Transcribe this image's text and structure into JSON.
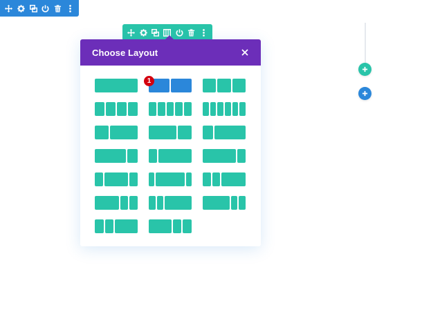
{
  "colors": {
    "section_blue": "#2b87da",
    "row_teal": "#29c4a9",
    "modal_purple": "#6c2eb9",
    "badge_red": "#d3000f"
  },
  "section_toolbar": {
    "icons": [
      "move-icon",
      "gear-icon",
      "duplicate-icon",
      "power-icon",
      "trash-icon",
      "more-icon"
    ]
  },
  "row_toolbar": {
    "icons": [
      "move-icon",
      "gear-icon",
      "duplicate-icon",
      "columns-icon",
      "power-icon",
      "trash-icon",
      "more-icon"
    ]
  },
  "modal": {
    "title": "Choose Layout",
    "close_icon": "close-icon",
    "badge": "1",
    "layouts": [
      {
        "id": "one-column",
        "cols": [
          1
        ]
      },
      {
        "id": "two-halves",
        "cols": [
          1,
          1
        ],
        "selected": true
      },
      {
        "id": "three-thirds",
        "cols": [
          1,
          1,
          1
        ]
      },
      {
        "id": "four-quarters",
        "cols": [
          1,
          1,
          1,
          1
        ]
      },
      {
        "id": "five-fifths",
        "cols": [
          1,
          1,
          1,
          1,
          1
        ]
      },
      {
        "id": "six-sixths",
        "cols": [
          1,
          1,
          1,
          1,
          1,
          1
        ]
      },
      {
        "id": "one-third-two-thirds",
        "cols": [
          1,
          2
        ]
      },
      {
        "id": "two-thirds-one-third",
        "cols": [
          2,
          1
        ]
      },
      {
        "id": "one-quarter-three-quarters",
        "cols": [
          1,
          3
        ]
      },
      {
        "id": "three-quarters-one-quarter",
        "cols": [
          3,
          1
        ]
      },
      {
        "id": "one-quarter-three-quarters-b",
        "cols": [
          1,
          4
        ]
      },
      {
        "id": "three-quarters-one-quarter-b",
        "cols": [
          4,
          1
        ]
      },
      {
        "id": "quarter-half-quarter",
        "cols": [
          1,
          3,
          1
        ]
      },
      {
        "id": "fifth-three-fifths-fifth",
        "cols": [
          1,
          5,
          1
        ]
      },
      {
        "id": "quarter-quarter-half",
        "cols": [
          1,
          1,
          3
        ]
      },
      {
        "id": "half-quarter-quarter",
        "cols": [
          3,
          1,
          1
        ]
      },
      {
        "id": "sixth-sixth-two-thirds",
        "cols": [
          1,
          1,
          4
        ]
      },
      {
        "id": "two-thirds-sixth-sixth",
        "cols": [
          4,
          1,
          1
        ]
      },
      {
        "id": "fourths-left",
        "cols": [
          1,
          1,
          2.6
        ]
      },
      {
        "id": "fourths-right",
        "cols": [
          2.6,
          1,
          1
        ]
      }
    ]
  },
  "right_controls": {
    "add_row_icon": "plus-icon",
    "add_section_icon": "plus-icon"
  }
}
